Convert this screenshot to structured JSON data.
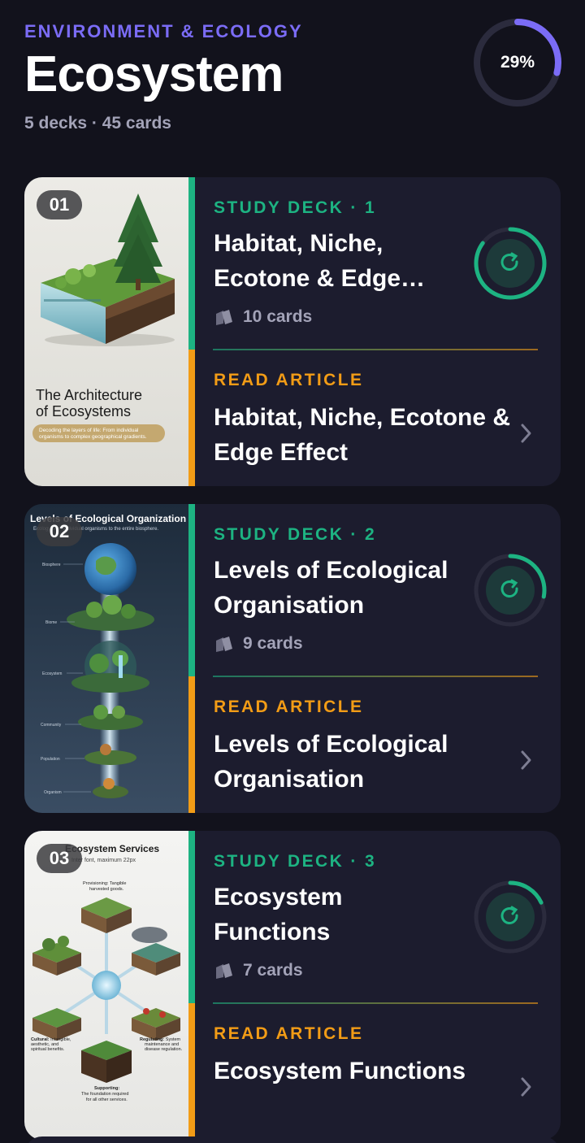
{
  "header": {
    "eyebrow": "ENVIRONMENT & ECOLOGY",
    "title": "Ecosystem",
    "subtitle": "5 decks · 45 cards",
    "progress_label": "29%",
    "progress_value": 0.29
  },
  "colors": {
    "accent_purple": "#7b6cf6",
    "study_green": "#1db382",
    "article_orange": "#f29c16",
    "card_bg": "#1c1c2e",
    "page_bg": "#12121c"
  },
  "icons": {
    "cards": "cards-icon",
    "refresh": "refresh-icon",
    "chevron": "chevron-right-icon"
  },
  "decks": [
    {
      "number": "01",
      "study_label": "STUDY DECK · 1",
      "title": "Habitat, Niche, Ecotone & Edge Effect",
      "cards": "10 cards",
      "deck_progress": 0.85,
      "article_label": "READ ARTICLE",
      "article_title": "Habitat, Niche, Ecotone & Edge Effect",
      "image": {
        "title": "The Architecture of Ecosystems",
        "caption": "Decoding the layers of life: From individual organisms to complex geographical gradients."
      }
    },
    {
      "number": "02",
      "study_label": "STUDY DECK · 2",
      "title": "Levels of Ecological Organisation",
      "cards": "9 cards",
      "deck_progress": 0.28,
      "article_label": "READ ARTICLE",
      "article_title": "Levels of Ecological Organisation",
      "image": {
        "title": "Levels of Ecological Organization",
        "caption": "Ecology from individual organisms to the entire biosphere.",
        "levels": [
          "Biosphere",
          "Biome",
          "Ecosystem",
          "Community",
          "Population",
          "Organism"
        ]
      }
    },
    {
      "number": "03",
      "study_label": "STUDY DECK · 3",
      "title": "Ecosystem Functions",
      "cards": "7 cards",
      "deck_progress": 0.18,
      "article_label": "READ ARTICLE",
      "article_title": "Ecosystem Functions",
      "image": {
        "title": "Ecosystem Services",
        "subtitle": "Inter font, maximum 22px",
        "provisioning": "Provisioning: Tangible harvested goods.",
        "cultural": "Cultural: Intangible, aesthetic, and spiritual benefits.",
        "regulating": "Regulating: System maintenance and disease regulation.",
        "supporting": "Supporting: The foundation required for all other services."
      }
    }
  ]
}
